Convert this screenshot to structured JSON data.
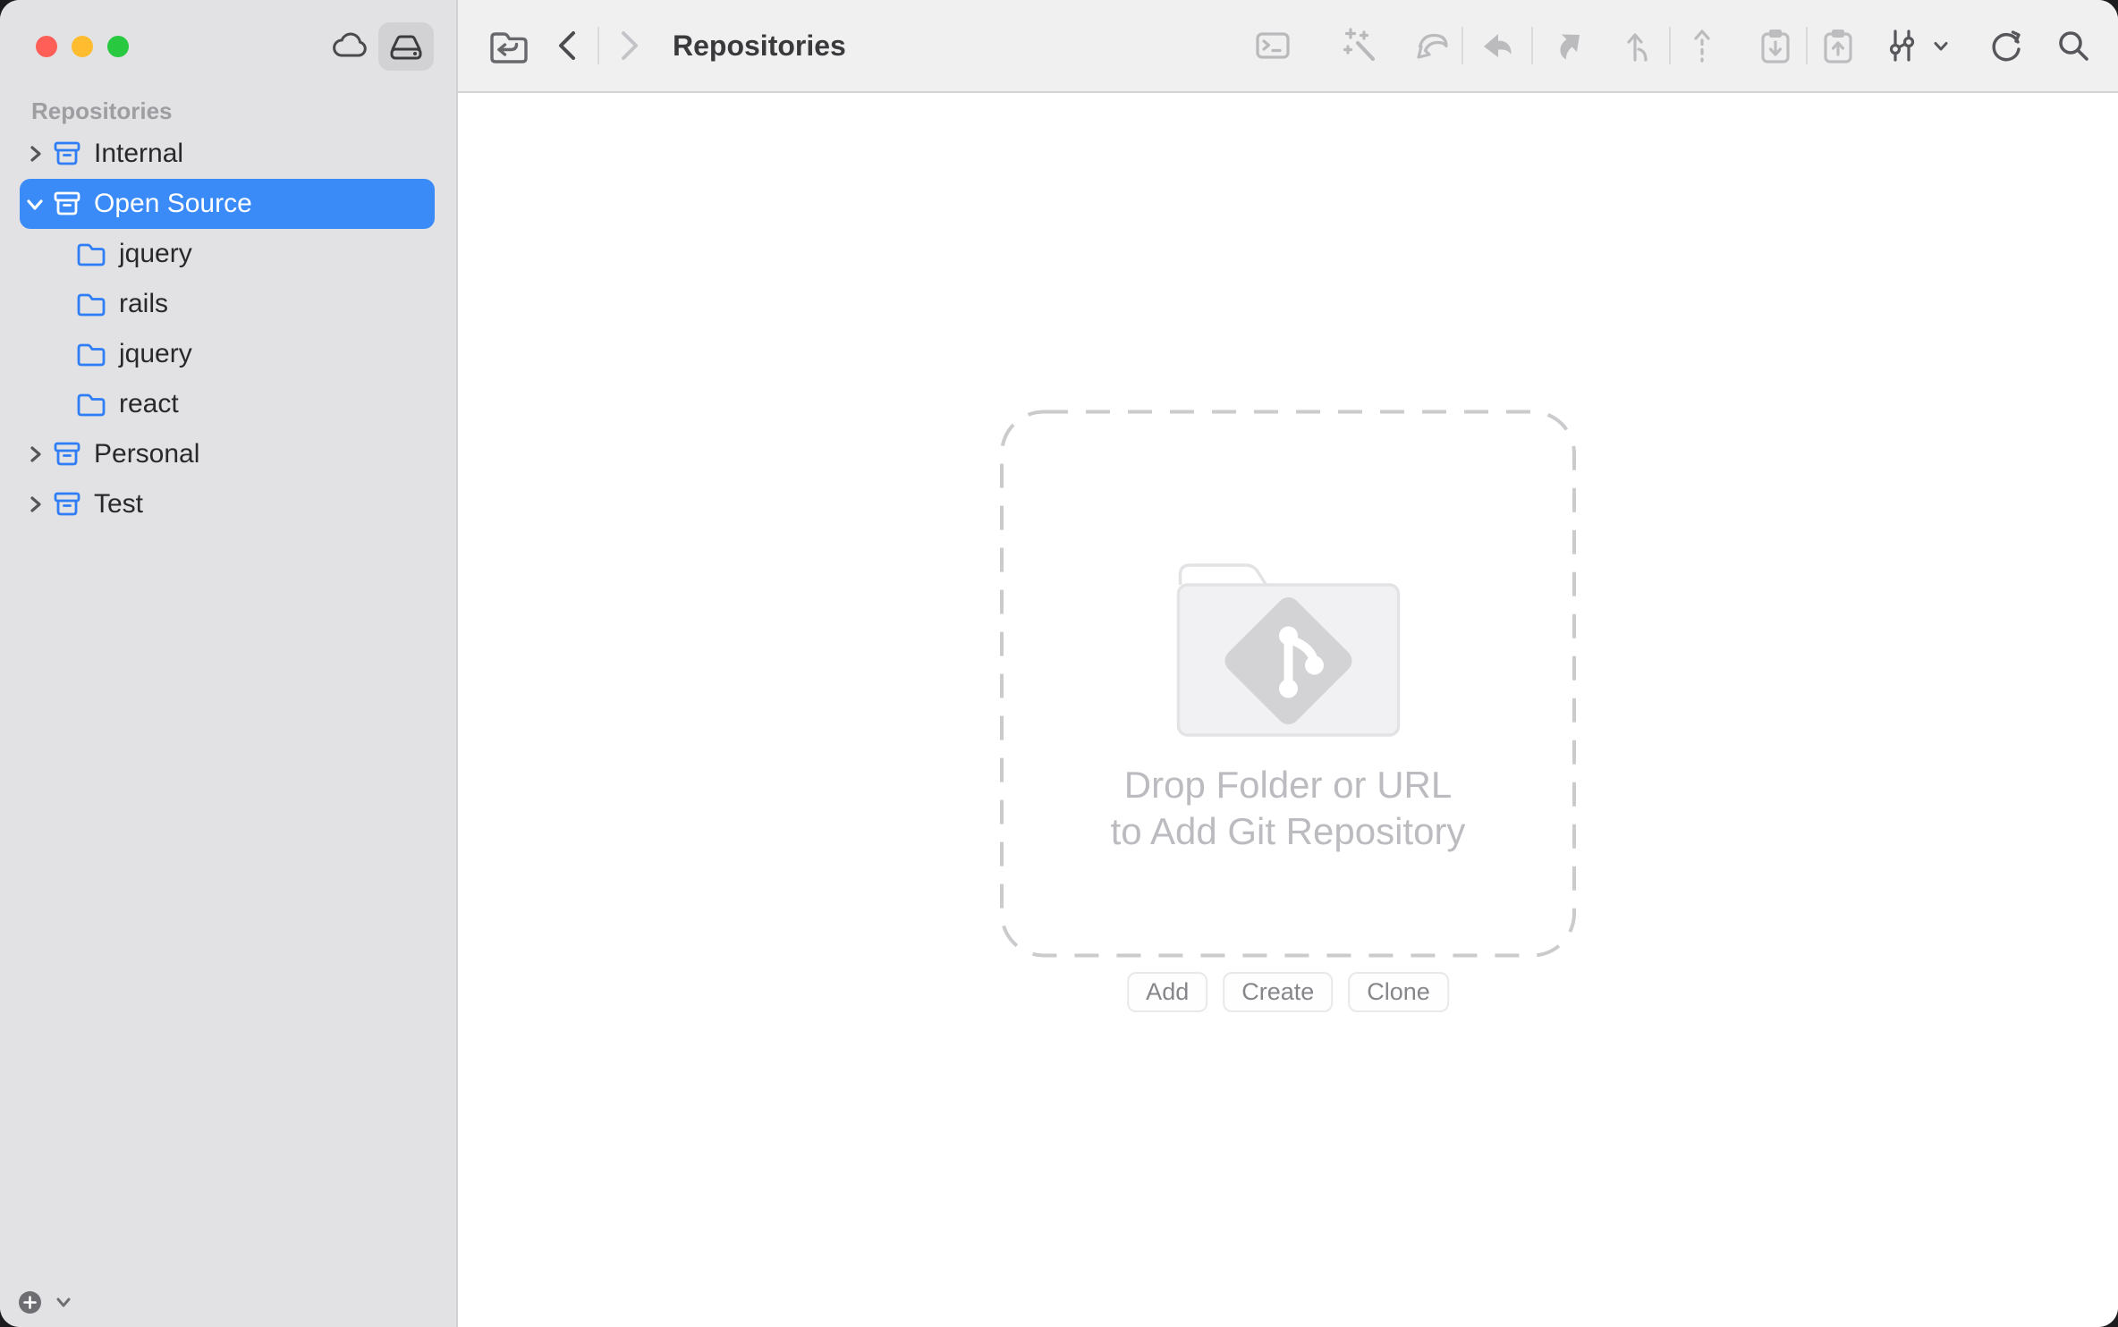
{
  "window": {
    "title": "Repositories"
  },
  "titlebar": {
    "traffic_lights": {
      "close": "#ff5f57",
      "minimize": "#febc2e",
      "zoom": "#28c840"
    },
    "source_switcher": {
      "options": [
        {
          "name": "remote-accounts",
          "icon": "cloud-icon",
          "selected": false
        },
        {
          "name": "local-repositories",
          "icon": "hard-drive-icon",
          "selected": true
        }
      ]
    }
  },
  "toolbar": {
    "title": "Repositories",
    "left_icons": [
      "open-repository-folder-icon",
      "back-icon",
      "forward-icon"
    ],
    "right_icons": [
      "terminal-icon",
      "quick-launch-icon",
      "fetch-icon",
      "pull-icon",
      "push-icon",
      "merge-icon",
      "rebase-icon",
      "stash-icon",
      "apply-stash-icon",
      "commit-graph-dropdown-icon",
      "refresh-icon",
      "search-icon"
    ]
  },
  "sidebar": {
    "header": "Repositories",
    "items": [
      {
        "label": "Internal",
        "type": "group",
        "state": "collapsed",
        "selected": false
      },
      {
        "label": "Open Source",
        "type": "group",
        "state": "expanded",
        "selected": true
      },
      {
        "label": "jquery",
        "type": "repo",
        "selected": false
      },
      {
        "label": "rails",
        "type": "repo",
        "selected": false
      },
      {
        "label": "jquery",
        "type": "repo",
        "selected": false
      },
      {
        "label": "react",
        "type": "repo",
        "selected": false
      },
      {
        "label": "Personal",
        "type": "group",
        "state": "collapsed",
        "selected": false
      },
      {
        "label": "Test",
        "type": "group",
        "state": "collapsed",
        "selected": false
      }
    ],
    "add_menu_icon": "plus-icon"
  },
  "dropzone": {
    "line1": "Drop Folder or URL",
    "line2": "to Add Git Repository",
    "icon": "git-folder-icon"
  },
  "actions": {
    "add": "Add",
    "create": "Create",
    "clone": "Clone"
  },
  "colors": {
    "accent_blue": "#3a8bf7",
    "sidebar_bg": "#e2e2e4",
    "toolbar_bg": "#f0f0f1",
    "content_bg": "#ffffff",
    "disabled_icon": "#b9b9bc",
    "enabled_icon": "#525256",
    "drop_text": "#bcbcc0",
    "dashed_border": "#cbcbcd"
  }
}
